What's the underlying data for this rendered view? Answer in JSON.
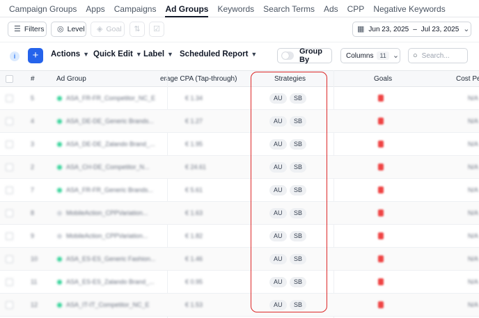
{
  "nav": {
    "tabs": [
      "Campaign Groups",
      "Apps",
      "Campaigns",
      "Ad Groups",
      "Keywords",
      "Search Terms",
      "Ads",
      "CPP",
      "Negative Keywords"
    ],
    "active_tab": "Ad Groups"
  },
  "toolbar1": {
    "filters_label": "Filters",
    "level_label": "Level",
    "goal_label": "Goal",
    "date_start": "Jun 23, 2025",
    "date_sep": "–",
    "date_end": "Jul 23, 2025"
  },
  "toolbar2": {
    "info": "i",
    "add": "+",
    "actions_label": "Actions",
    "quick_edit_label": "Quick Edit",
    "label_label": "Label",
    "scheduled_report_label": "Scheduled Report",
    "group_by_label": "Group By",
    "columns_label": "Columns",
    "columns_count": "11",
    "search_placeholder": "Search..."
  },
  "table": {
    "headers": {
      "number": "#",
      "ad_group": "Ad Group",
      "avg_cpa": "erage CPA (Tap-through)",
      "strategies": "Strategies",
      "goals": "Goals",
      "cost_per": "Cost Per"
    },
    "rows": [
      {
        "num": "5",
        "name": "ASA_FR-FR_Competitor_NC_E",
        "cpa": "€ 1.34",
        "status": "green",
        "strategies": [
          "AU",
          "SB"
        ],
        "cost": "N/A"
      },
      {
        "num": "4",
        "name": "ASA_DE-DE_Generic Brands...",
        "cpa": "€ 1.27",
        "status": "green",
        "strategies": [
          "AU",
          "SB"
        ],
        "cost": "N/A"
      },
      {
        "num": "3",
        "name": "ASA_DE-DE_Zalando Brand_...",
        "cpa": "€ 1.95",
        "status": "green",
        "strategies": [
          "AU",
          "SB"
        ],
        "cost": "N/A"
      },
      {
        "num": "2",
        "name": "ASA_CH-DE_Competitor_N...",
        "cpa": "€ 24.61",
        "status": "green",
        "strategies": [
          "AU",
          "SB"
        ],
        "cost": "N/A"
      },
      {
        "num": "7",
        "name": "ASA_FR-FR_Generic Brands...",
        "cpa": "€ 5.61",
        "status": "green",
        "strategies": [
          "AU",
          "SB"
        ],
        "cost": "N/A"
      },
      {
        "num": "8",
        "name": "MobileAction_CPPVariation...",
        "cpa": "€ 1.63",
        "status": "grey",
        "strategies": [
          "AU",
          "SB"
        ],
        "cost": "N/A"
      },
      {
        "num": "9",
        "name": "MobileAction_CPPVariation...",
        "cpa": "€ 1.82",
        "status": "grey",
        "strategies": [
          "AU",
          "SB"
        ],
        "cost": "N/A"
      },
      {
        "num": "10",
        "name": "ASA_ES-ES_Generic Fashion...",
        "cpa": "€ 1.46",
        "status": "green",
        "strategies": [
          "AU",
          "SB"
        ],
        "cost": "N/A"
      },
      {
        "num": "11",
        "name": "ASA_ES-ES_Zalando Brand_...",
        "cpa": "€ 0.95",
        "status": "green",
        "strategies": [
          "AU",
          "SB"
        ],
        "cost": "N/A"
      },
      {
        "num": "12",
        "name": "ASA_IT-IT_Competitor_NC_E",
        "cpa": "€ 1.53",
        "status": "green",
        "strategies": [
          "AU",
          "SB"
        ],
        "cost": "N/A"
      }
    ]
  },
  "colors": {
    "accent": "#2563eb",
    "highlight": "#dc2626",
    "status_green": "#34d399",
    "goal_red": "#ef4444"
  }
}
